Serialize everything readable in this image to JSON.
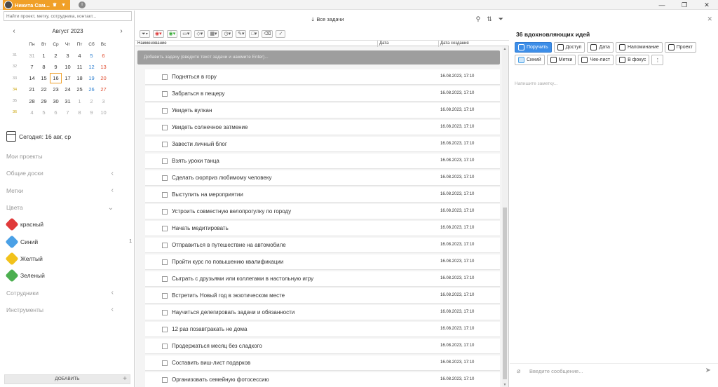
{
  "titlebar": {
    "user_name": "Никита Сам...",
    "window_buttons": [
      "—",
      "❐",
      "✕"
    ]
  },
  "sidebar": {
    "search_placeholder": "Найти проект, метку, сотрудника, контакт...",
    "calendar": {
      "month": "Август 2023",
      "weekdays": [
        "Пн",
        "Вт",
        "Ср",
        "Чт",
        "Пт",
        "Сб",
        "Вс"
      ],
      "weeks": [
        {
          "wk": "31",
          "days": [
            "31",
            "1",
            "2",
            "3",
            "4",
            "5",
            "6"
          ]
        },
        {
          "wk": "32",
          "days": [
            "7",
            "8",
            "9",
            "10",
            "11",
            "12",
            "13"
          ]
        },
        {
          "wk": "33",
          "days": [
            "14",
            "15",
            "16",
            "17",
            "18",
            "19",
            "20"
          ]
        },
        {
          "wk": "34",
          "days": [
            "21",
            "22",
            "23",
            "24",
            "25",
            "26",
            "27"
          ]
        },
        {
          "wk": "35",
          "days": [
            "28",
            "29",
            "30",
            "31",
            "1",
            "2",
            "3"
          ]
        },
        {
          "wk": "36",
          "days": [
            "4",
            "5",
            "6",
            "7",
            "8",
            "9",
            "10"
          ]
        }
      ]
    },
    "today_label": "Сегодня: 16 авг, ср",
    "nav": [
      {
        "label": "Мои проекты",
        "chevron": ""
      },
      {
        "label": "Общие доски",
        "chevron": "‹"
      },
      {
        "label": "Метки",
        "chevron": "‹"
      },
      {
        "label": "Цвета",
        "chevron": "⌄"
      },
      {
        "label": "красный",
        "color": "#e03a3a",
        "count": ""
      },
      {
        "label": "Синий",
        "color": "#4aa0e6",
        "count": "1"
      },
      {
        "label": "Желтый",
        "color": "#f2c21b",
        "count": ""
      },
      {
        "label": "Зеленый",
        "color": "#4caf50",
        "count": ""
      },
      {
        "label": "Сотрудники",
        "chevron": "‹"
      },
      {
        "label": "Инструменты",
        "chevron": "‹"
      }
    ],
    "add_button": "ДОБАВИТЬ",
    "add_plus": "+"
  },
  "main": {
    "title": "⇣ Все задачи",
    "columns": {
      "name": "Наименование",
      "date": "Дата",
      "created": "Дата создания"
    },
    "add_task_placeholder": "Добавить задачу (введите текст задачи и нажмите Enter)...",
    "tasks": [
      {
        "name": "Подняться в гору",
        "created": "16.08.2023, 17:10"
      },
      {
        "name": "Забраться в пещеру",
        "created": "16.08.2023, 17:10"
      },
      {
        "name": "Увидеть вулкан",
        "created": "16.08.2023, 17:10"
      },
      {
        "name": "Увидеть солнечное затмение",
        "created": "16.08.2023, 17:10"
      },
      {
        "name": "Завести личный блог",
        "created": "16.08.2023, 17:10"
      },
      {
        "name": "Взять уроки танца",
        "created": "16.08.2023, 17:10"
      },
      {
        "name": "Сделать сюрприз любимому человеку",
        "created": "16.08.2023, 17:10"
      },
      {
        "name": "Выступить на мероприятии",
        "created": "16.08.2023, 17:10"
      },
      {
        "name": "Устроить совместную велопрогулку по городу",
        "created": "16.08.2023, 17:10"
      },
      {
        "name": "Начать медитировать",
        "created": "16.08.2023, 17:10"
      },
      {
        "name": "Отправиться в путешествие на автомобиле",
        "created": "16.08.2023, 17:10"
      },
      {
        "name": "Пройти курс по повышению квалификации",
        "created": "16.08.2023, 17:10"
      },
      {
        "name": "Сыграть с друзьями или коллегами в настольную игру",
        "created": "16.08.2023, 17:10"
      },
      {
        "name": "Встретить Новый год в экзотическом месте",
        "created": "16.08.2023, 17:10"
      },
      {
        "name": "Научиться делегировать задачи и обязанности",
        "created": "16.08.2023, 17:10"
      },
      {
        "name": "12 раз позавтракать не дома",
        "created": "16.08.2023, 17:10"
      },
      {
        "name": "Продержаться месяц без сладкого",
        "created": "16.08.2023, 17:10"
      },
      {
        "name": "Составить виш-лист подарков",
        "created": "16.08.2023, 17:10"
      },
      {
        "name": "Организовать семейную фотосессию",
        "created": "16.08.2023, 17:10"
      }
    ]
  },
  "detail": {
    "title": "36 вдохновляющих идей",
    "buttons_row1": [
      "Поручить",
      "Доступ",
      "Дата",
      "Напоминание",
      "Проект"
    ],
    "buttons_row2": [
      "Синий",
      "Метки",
      "Чек-лист",
      "В фокус",
      "⋮"
    ],
    "note_placeholder": "Напишите заметку...",
    "message_placeholder": "Введите сообщение..."
  }
}
